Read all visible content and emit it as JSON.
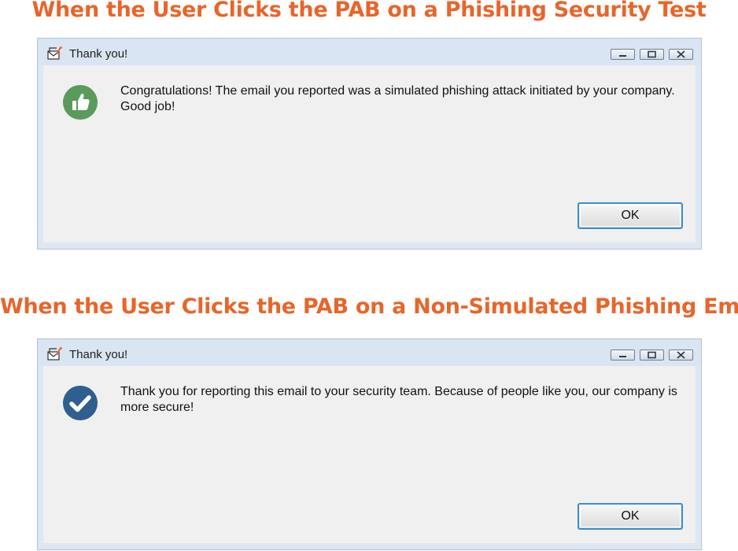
{
  "dialogs": [
    {
      "heading": "When the User Clicks the PAB on a Phishing Security Test",
      "window_title": "Thank you!",
      "message": "Congratulations! The email you reported was a simulated phishing attack initiated by your company. Good job!",
      "ok_label": "OK",
      "status_icon": "thumbs-up-icon",
      "icon_color": "#5a9a5c"
    },
    {
      "heading": "When the User Clicks the PAB on a Non-Simulated Phishing Email",
      "window_title": "Thank you!",
      "message": "Thank you for reporting this email to your security team. Because of people like you, our company is more secure!",
      "ok_label": "OK",
      "status_icon": "checkmark-icon",
      "icon_color": "#2f5f8f"
    }
  ],
  "colors": {
    "heading": "#e8652a",
    "window_frame": "#dde8f3",
    "client_area": "#f0f0f0",
    "button_focus_border": "#3a8ed0"
  }
}
